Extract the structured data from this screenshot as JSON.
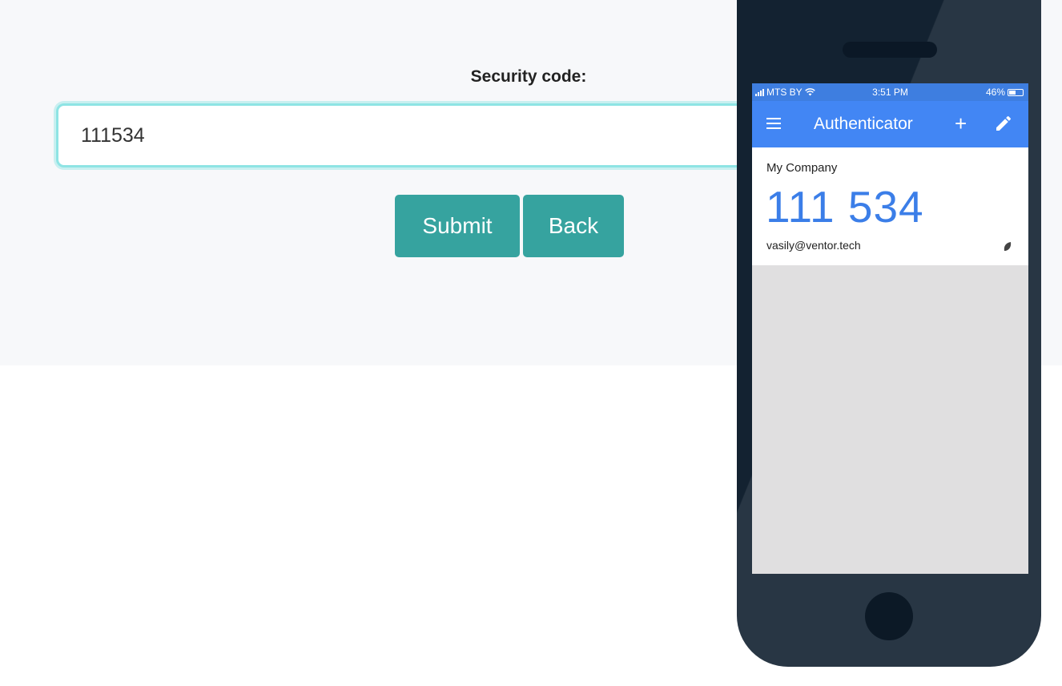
{
  "form": {
    "security_label": "Security code:",
    "code_value": "111534",
    "submit_label": "Submit",
    "back_label": "Back"
  },
  "phone": {
    "status_bar": {
      "carrier": "MTS BY",
      "time": "3:51 PM",
      "battery": "46%"
    },
    "app_bar": {
      "title": "Authenticator",
      "menu_icon": "hamburger-menu-icon",
      "add_icon": "plus-icon",
      "edit_icon": "pencil-icon"
    },
    "account": {
      "issuer": "My Company",
      "code": "111 534",
      "email": "vasily@ventor.tech",
      "timer_icon": "countdown-timer-icon"
    }
  },
  "colors": {
    "accent_teal": "#36a39f",
    "input_focus": "#8ee4e4",
    "app_blue": "#4286f4",
    "code_blue": "#3b7ee8",
    "phone_body": "#132231"
  }
}
